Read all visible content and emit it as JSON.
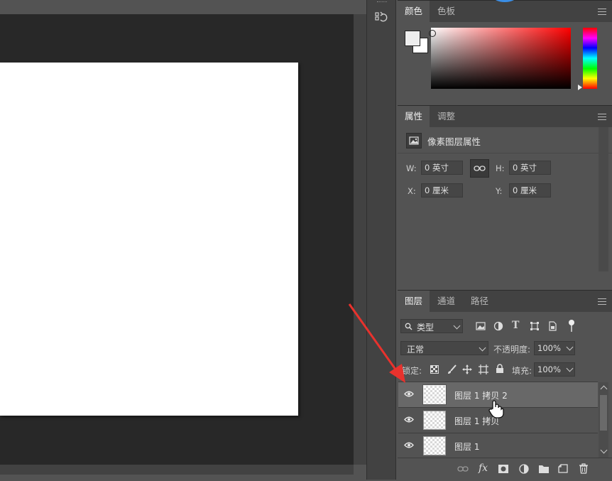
{
  "color_panel": {
    "tabs": [
      {
        "label": "颜色",
        "active": true
      },
      {
        "label": "色板",
        "active": false
      }
    ],
    "foreground_color": "#eeeeee",
    "background_color": "#ffffff",
    "picker_hue": "#ff0000"
  },
  "properties_panel": {
    "tabs": [
      {
        "label": "属性",
        "active": true
      },
      {
        "label": "调整",
        "active": false
      }
    ],
    "header": "像素图层属性",
    "w_label": "W:",
    "w_value": "0 英寸",
    "h_label": "H:",
    "h_value": "0 英寸",
    "x_label": "X:",
    "x_value": "0 厘米",
    "y_label": "Y:",
    "y_value": "0 厘米"
  },
  "layers_panel": {
    "tabs": [
      {
        "label": "图层",
        "active": true
      },
      {
        "label": "通道",
        "active": false
      },
      {
        "label": "路径",
        "active": false
      }
    ],
    "filter_kind": "类型",
    "blend_mode": "正常",
    "opacity_label": "不透明度:",
    "opacity_value": "100%",
    "lock_label": "锁定:",
    "fill_label": "填充:",
    "fill_value": "100%",
    "layers": [
      {
        "name": "图层 1 拷贝 2",
        "selected": true,
        "visible": true
      },
      {
        "name": "图层 1 拷贝",
        "selected": false,
        "visible": true
      },
      {
        "name": "图层 1",
        "selected": false,
        "visible": true
      }
    ],
    "footer_fx": "fx"
  },
  "annotation_color": "#e8322d"
}
